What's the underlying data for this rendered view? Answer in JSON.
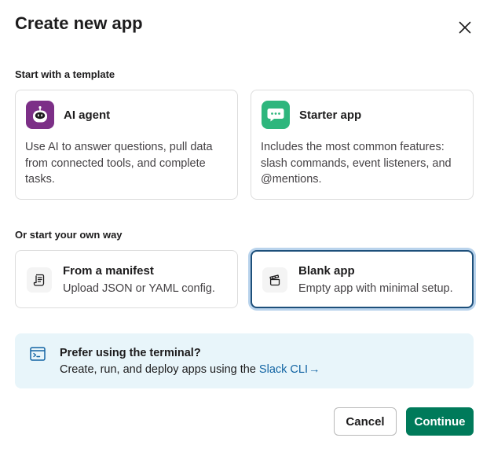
{
  "dialog": {
    "title": "Create new app"
  },
  "templates": {
    "section_label": "Start with a template",
    "items": [
      {
        "title": "AI agent",
        "description": "Use AI to answer questions, pull data from connected tools, and complete tasks.",
        "icon": "robot-icon",
        "icon_color": "#7c2f87"
      },
      {
        "title": "Starter app",
        "description": "Includes the most common features: slash commands, event listeners, and @mentions.",
        "icon": "chat-bubble-icon",
        "icon_color": "#2eb67d"
      }
    ]
  },
  "own_way": {
    "section_label": "Or start your own way",
    "items": [
      {
        "title": "From a manifest",
        "description": "Upload JSON or YAML config.",
        "icon": "manifest-icon",
        "selected": false
      },
      {
        "title": "Blank app",
        "description": "Empty app with minimal setup.",
        "icon": "blank-app-icon",
        "selected": true
      }
    ]
  },
  "terminal": {
    "title": "Prefer using the terminal?",
    "description": "Create, run, and deploy apps using the ",
    "link_text": "Slack CLI",
    "link_arrow": "→",
    "icon": "terminal-icon"
  },
  "footer": {
    "cancel_label": "Cancel",
    "continue_label": "Continue"
  },
  "colors": {
    "primary": "#007a5a",
    "link": "#1264a3",
    "selected_border": "#1d4f7a",
    "terminal_bg": "#e8f5fa"
  }
}
